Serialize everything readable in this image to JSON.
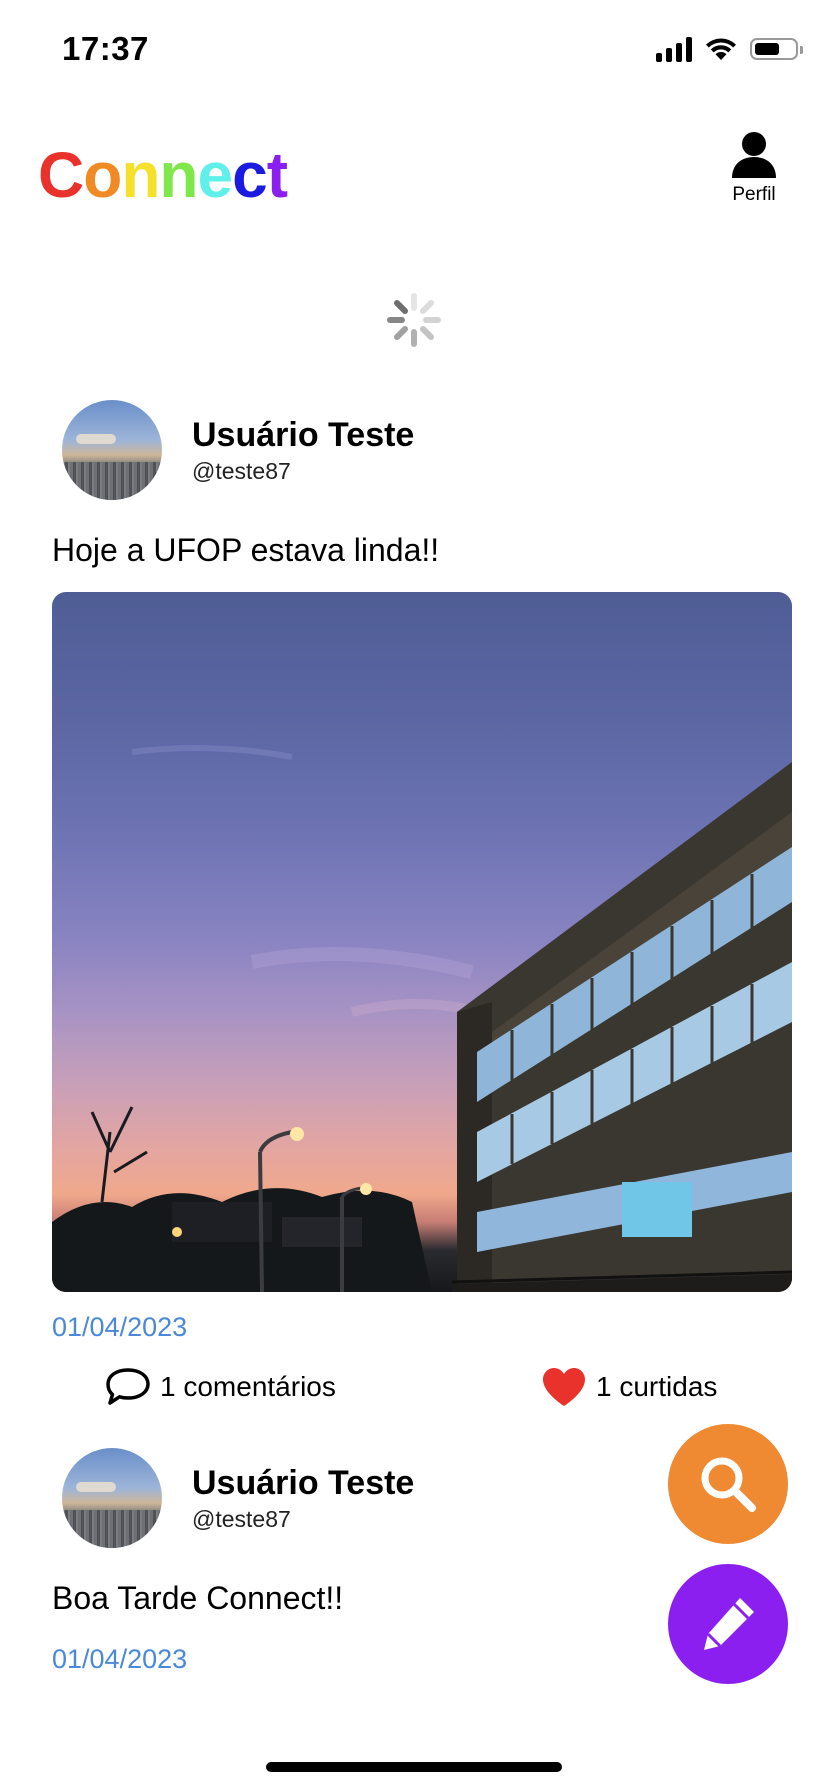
{
  "status_bar": {
    "time": "17:37"
  },
  "header": {
    "logo_letters": [
      {
        "char": "C",
        "color": "#e8322b"
      },
      {
        "char": "o",
        "color": "#f08a24"
      },
      {
        "char": "n",
        "color": "#f5e02c"
      },
      {
        "char": "n",
        "color": "#7ee84a"
      },
      {
        "char": "e",
        "color": "#5ff0ea"
      },
      {
        "char": "c",
        "color": "#1a1ae0"
      },
      {
        "char": "t",
        "color": "#8a1ff0"
      }
    ],
    "profile_label": "Perfil",
    "profile_icon": "person-icon"
  },
  "posts": [
    {
      "user_name": "Usuário Teste",
      "user_handle": "@teste87",
      "text": "Hoje a UFOP estava linda!!",
      "has_photo": true,
      "date": "01/04/2023",
      "comments_label": "1 comentários",
      "likes_label": "1 curtidas"
    },
    {
      "user_name": "Usuário Teste",
      "user_handle": "@teste87",
      "text": "Boa Tarde Connect!!",
      "has_photo": false,
      "date": "01/04/2023"
    }
  ],
  "fabs": {
    "search_icon": "search-icon",
    "edit_icon": "pencil-icon",
    "search_color": "#ef8a33",
    "edit_color": "#8a1ff0"
  },
  "colors": {
    "date_link": "#4a88d8",
    "like_heart": "#e8322b"
  }
}
